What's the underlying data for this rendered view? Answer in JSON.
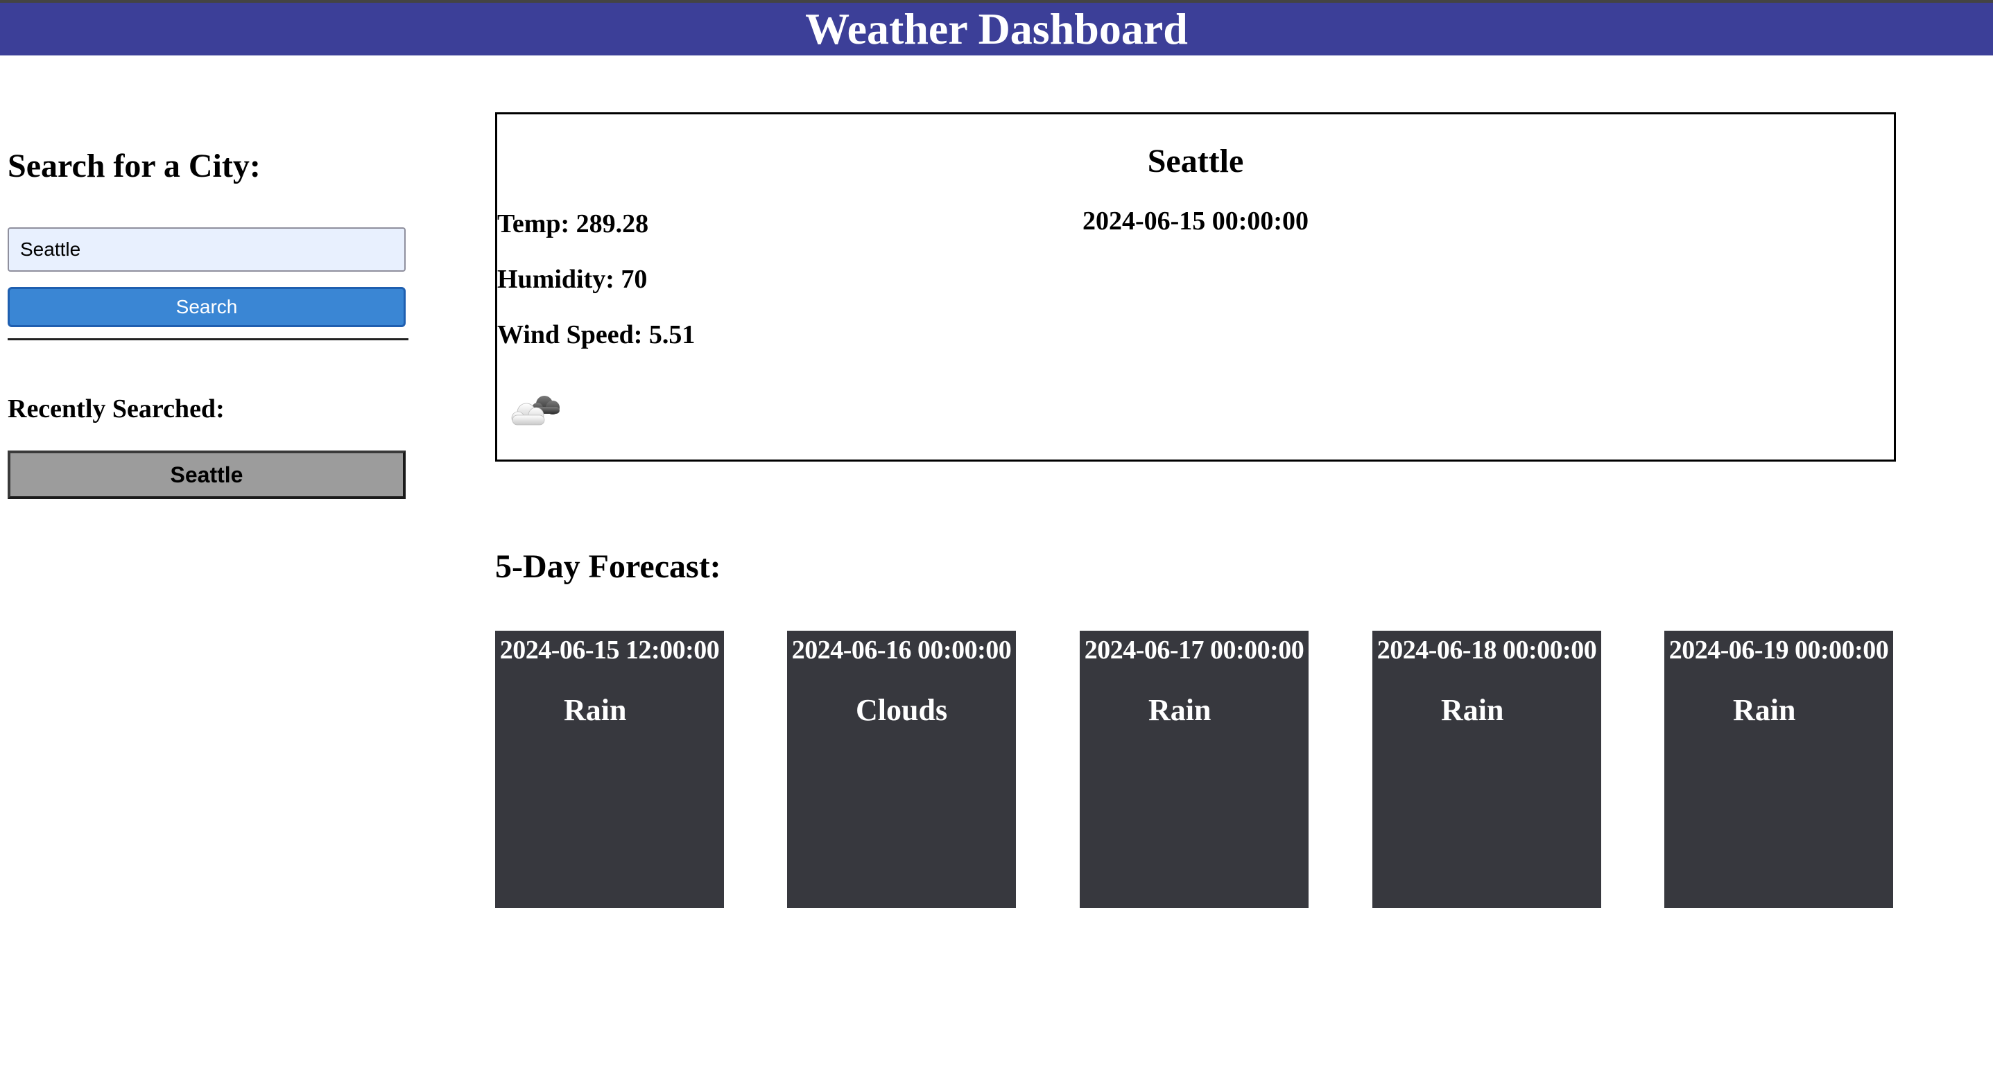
{
  "header": {
    "title": "Weather Dashboard"
  },
  "sidebar": {
    "search_heading": "Search for a City:",
    "search_input_value": "Seattle",
    "search_button_label": "Search",
    "recent_heading": "Recently Searched:",
    "recent_items": [
      "Seattle"
    ]
  },
  "current": {
    "city": "Seattle",
    "date": "2024-06-15 00:00:00",
    "temp": "Temp: 289.28",
    "humidity": "Humidity: 70",
    "wind": "Wind Speed: 5.51",
    "icon": "cloudy-icon"
  },
  "forecast": {
    "heading": "5-Day Forecast:",
    "days": [
      {
        "date": "2024-06-15 12:00:00",
        "description": "Rain"
      },
      {
        "date": "2024-06-16 00:00:00",
        "description": "Clouds"
      },
      {
        "date": "2024-06-17 00:00:00",
        "description": "Rain"
      },
      {
        "date": "2024-06-18 00:00:00",
        "description": "Rain"
      },
      {
        "date": "2024-06-19 00:00:00",
        "description": "Rain"
      }
    ]
  },
  "colors": {
    "header_bg": "#3c3f98",
    "search_button_bg": "#3a86d4",
    "recent_button_bg": "#9c9c9c",
    "forecast_card_bg": "#37383e"
  }
}
